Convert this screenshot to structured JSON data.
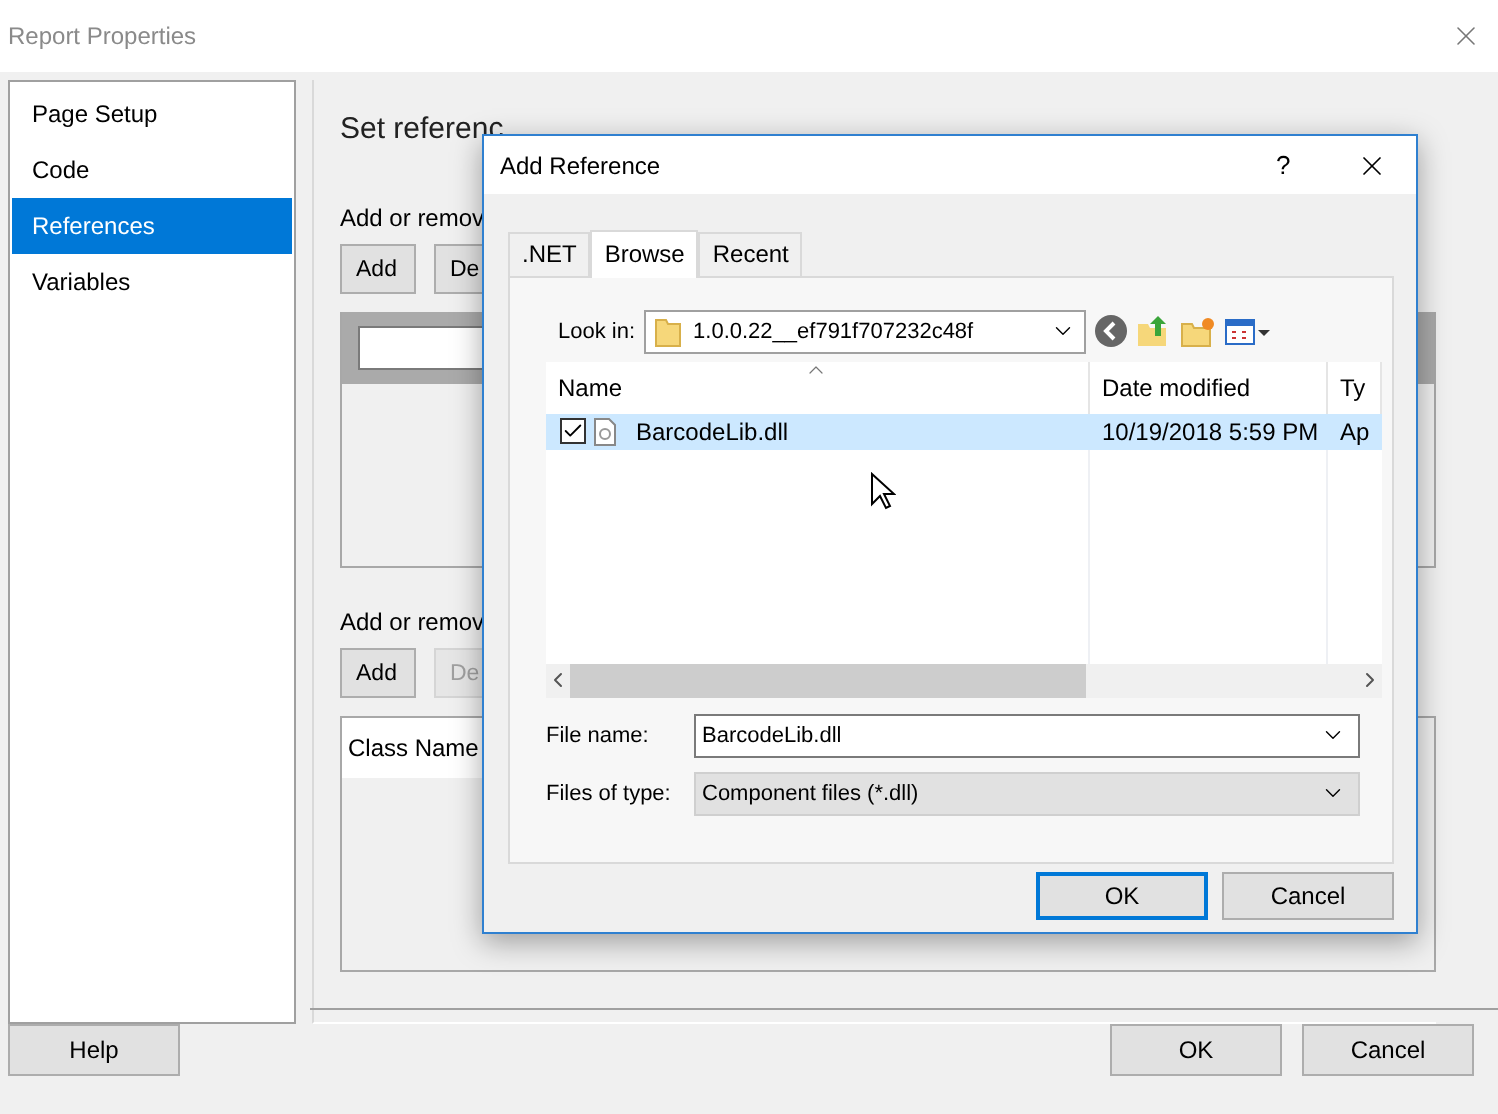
{
  "window": {
    "title": "Report Properties"
  },
  "sidebar": {
    "items": [
      {
        "label": "Page Setup",
        "selected": false
      },
      {
        "label": "Code",
        "selected": false
      },
      {
        "label": "References",
        "selected": true
      },
      {
        "label": "Variables",
        "selected": false
      }
    ]
  },
  "content": {
    "heading": "Set referenc",
    "assemblies": {
      "label": "Add or remov",
      "buttons": [
        {
          "label": "Add",
          "disabled": false
        },
        {
          "label": "De",
          "disabled": false
        }
      ]
    },
    "classes": {
      "label": "Add or remov",
      "buttons": [
        {
          "label": "Add",
          "disabled": false
        },
        {
          "label": "De",
          "disabled": true
        }
      ],
      "columns": [
        "Class Name"
      ]
    }
  },
  "footer": {
    "left": [
      "Help"
    ],
    "right": [
      "OK",
      "Cancel"
    ]
  },
  "modal": {
    "title": "Add Reference",
    "help": "?",
    "tabs": [
      {
        "label": ".NET",
        "selected": false
      },
      {
        "label": "Browse",
        "selected": true
      },
      {
        "label": "Recent",
        "selected": false
      }
    ],
    "look_in": {
      "label": "Look in:",
      "value": "1.0.0.22__ef791f707232c48f"
    },
    "files": {
      "columns": [
        "Name",
        "Date modified",
        "Ty"
      ],
      "rows": [
        {
          "name": "BarcodeLib.dll",
          "date": "10/19/2018 5:59 PM",
          "type": "Ap",
          "checked": true,
          "selected": true
        }
      ]
    },
    "file_name": {
      "label": "File name:",
      "value": "BarcodeLib.dll"
    },
    "file_type": {
      "label": "Files of type:",
      "value": "Component files (*.dll)"
    },
    "buttons": [
      {
        "label": "OK",
        "default": true
      },
      {
        "label": "Cancel",
        "default": false
      }
    ]
  }
}
